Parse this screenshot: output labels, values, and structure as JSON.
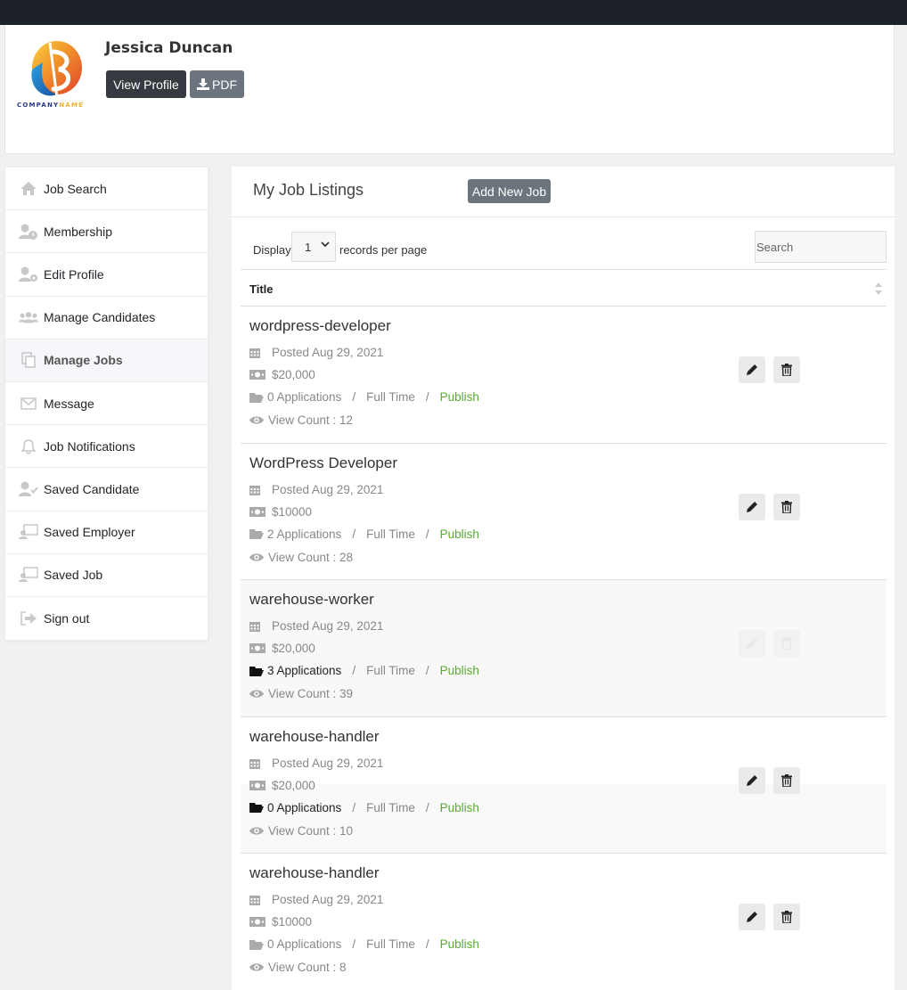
{
  "profile": {
    "company_logo_text_1": "COMPANY",
    "company_logo_text_2": "NAME",
    "name": "Jessica Duncan",
    "view_profile_label": "View Profile",
    "pdf_label": "PDF"
  },
  "sidebar": {
    "items": [
      {
        "label": "Job Search",
        "icon": "home-icon"
      },
      {
        "label": "Membership",
        "icon": "user-clock-icon"
      },
      {
        "label": "Edit Profile",
        "icon": "user-cog-icon"
      },
      {
        "label": "Manage Candidates",
        "icon": "users-icon"
      },
      {
        "label": "Manage Jobs",
        "icon": "copy-icon",
        "active": true
      },
      {
        "label": "Message",
        "icon": "envelope-icon"
      },
      {
        "label": "Job Notifications",
        "icon": "bell-icon"
      },
      {
        "label": "Saved Candidate",
        "icon": "user-check-icon"
      },
      {
        "label": "Saved Employer",
        "icon": "chalkboard-user-icon"
      },
      {
        "label": "Saved Job",
        "icon": "chalkboard-user-icon"
      },
      {
        "label": "Sign out",
        "icon": "sign-out-icon"
      }
    ]
  },
  "main": {
    "title": "My Job Listings",
    "add_button_label": "Add New Job",
    "display_label": "Display",
    "per_page_value": "1",
    "records_label": "records per page",
    "search_placeholder": "Search",
    "column_title": "Title"
  },
  "jobs": [
    {
      "title": "wordpress-developer",
      "posted": "Posted Aug 29, 2021",
      "salary": "$20,000",
      "applications": "0 Applications",
      "type": "Full Time",
      "status": "Publish",
      "views": "View Count : 12"
    },
    {
      "title": "WordPress Developer",
      "posted": "Posted Aug 29, 2021",
      "salary": "$10000",
      "applications": "2 Applications",
      "type": "Full Time",
      "status": "Publish",
      "views": "View Count : 28"
    },
    {
      "title": "warehouse-worker",
      "posted": "Posted Aug 29, 2021",
      "salary": "$20,000",
      "applications": "3 Applications",
      "type": "Full Time",
      "status": "Publish",
      "views": "View Count : 39"
    },
    {
      "title": "warehouse-handler",
      "posted": "Posted Aug 29, 2021",
      "salary": "$20,000",
      "applications": "0 Applications",
      "type": "Full Time",
      "status": "Publish",
      "views": "View Count : 10"
    },
    {
      "title": "warehouse-handler",
      "posted": "Posted Aug 29, 2021",
      "salary": "$10000",
      "applications": "0 Applications",
      "type": "Full Time",
      "status": "Publish",
      "views": "View Count : 8"
    }
  ],
  "separator": "/",
  "colors": {
    "topbar": "#1c2228",
    "dark_button": "#343a40",
    "gray_button": "#6c757d",
    "publish": "#5aab32"
  }
}
